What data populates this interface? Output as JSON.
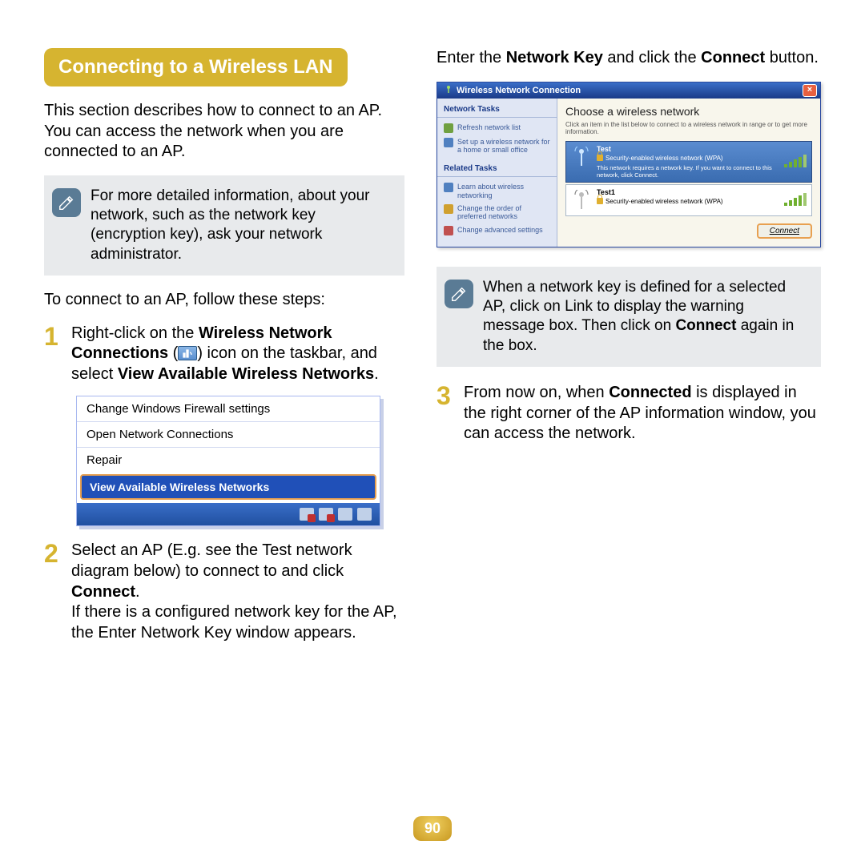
{
  "heading": "Connecting to a Wireless LAN",
  "intro": "This section describes how to connect to an AP. You can access the network when you are connected to an AP.",
  "note1": "For more detailed information, about your network, such as the network key (encryption key), ask your network administrator.",
  "follow": "To connect to an AP, follow these steps:",
  "step1": {
    "num": "1",
    "a": "Right-click on the ",
    "b": "Wireless Network Connections",
    "c": " (",
    "d": ") icon on the taskbar, and select ",
    "e": "View Available Wireless Networks",
    "f": "."
  },
  "ctx": {
    "i1": "Change Windows Firewall settings",
    "i2": "Open Network Connections",
    "i3": "Repair",
    "hl": "View Available Wireless Networks"
  },
  "step2": {
    "num": "2",
    "a": "Select an AP (E.g. see the Test network diagram below) to connect to and click ",
    "b": "Connect",
    "c": ".",
    "rest": "If there is a configured network key for the AP, the Enter Network Key window appears."
  },
  "col2top": {
    "a": "Enter the ",
    "b": "Network Key",
    "c": " and click the ",
    "d": "Connect",
    "e": " button."
  },
  "wdlg": {
    "title": "Wireless Network Connection",
    "sideH1": "Network Tasks",
    "link1": "Refresh network list",
    "link2": "Set up a wireless network for a home or small office",
    "sideH2": "Related Tasks",
    "link3": "Learn about wireless networking",
    "link4": "Change the order of preferred networks",
    "link5": "Change advanced settings",
    "mainH": "Choose a wireless network",
    "mainSub": "Click an item in the list below to connect to a wireless network in range or to get more information.",
    "net1": {
      "name": "Test",
      "sub": "Security-enabled wireless network (WPA)",
      "desc": "This network requires a network key. If you want to connect to this network, click Connect."
    },
    "net2": {
      "name": "Test1",
      "sub": "Security-enabled wireless network (WPA)"
    },
    "connect": "Connect"
  },
  "note2": {
    "a": "When a network key is defined for a selected AP, click on Link to display the warning message box. Then click on ",
    "b": "Connect",
    "c": " again in the box."
  },
  "step3": {
    "num": "3",
    "a": "From now on, when ",
    "b": "Connected",
    "c": " is displayed in the right corner of the AP information window, you can access the network."
  },
  "page": "90"
}
